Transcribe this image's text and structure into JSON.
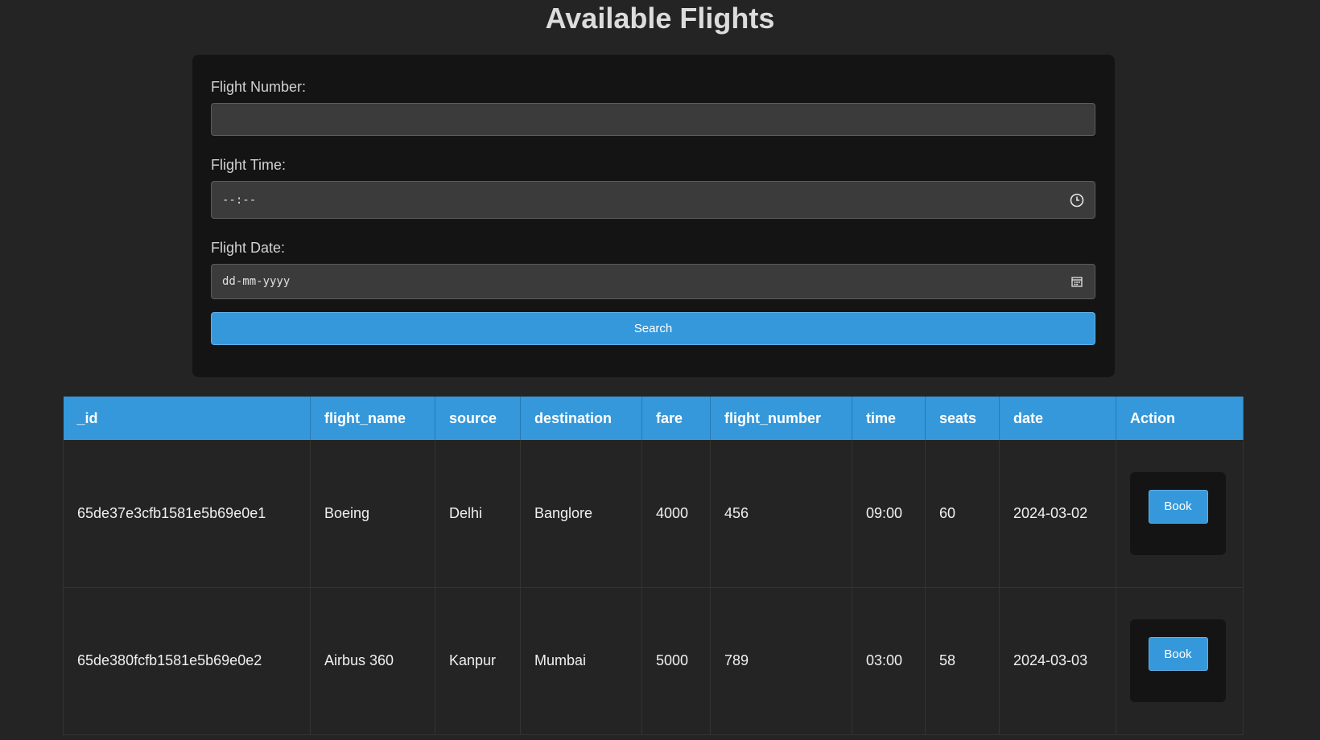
{
  "page": {
    "title": "Available Flights"
  },
  "search_form": {
    "flight_number": {
      "label": "Flight Number:",
      "value": ""
    },
    "flight_time": {
      "label": "Flight Time:",
      "placeholder": "--:--",
      "icon": "clock-icon"
    },
    "flight_date": {
      "label": "Flight Date:",
      "placeholder": "dd-mm-yyyy",
      "icon": "calendar-icon"
    },
    "search_label": "Search"
  },
  "table": {
    "columns": [
      "_id",
      "flight_name",
      "source",
      "destination",
      "fare",
      "flight_number",
      "time",
      "seats",
      "date",
      "Action"
    ],
    "rows": [
      {
        "_id": "65de37e3cfb1581e5b69e0e1",
        "flight_name": "Boeing",
        "source": "Delhi",
        "destination": "Banglore",
        "fare": "4000",
        "flight_number": "456",
        "time": "09:00",
        "seats": "60",
        "date": "2024-03-02",
        "action_label": "Book"
      },
      {
        "_id": "65de380fcfb1581e5b69e0e2",
        "flight_name": "Airbus 360",
        "source": "Kanpur",
        "destination": "Mumbai",
        "fare": "5000",
        "flight_number": "789",
        "time": "03:00",
        "seats": "58",
        "date": "2024-03-03",
        "action_label": "Book"
      }
    ]
  },
  "colors": {
    "background": "#242424",
    "panel": "#141414",
    "accent": "#3498db",
    "input_background": "#3b3b3b"
  }
}
